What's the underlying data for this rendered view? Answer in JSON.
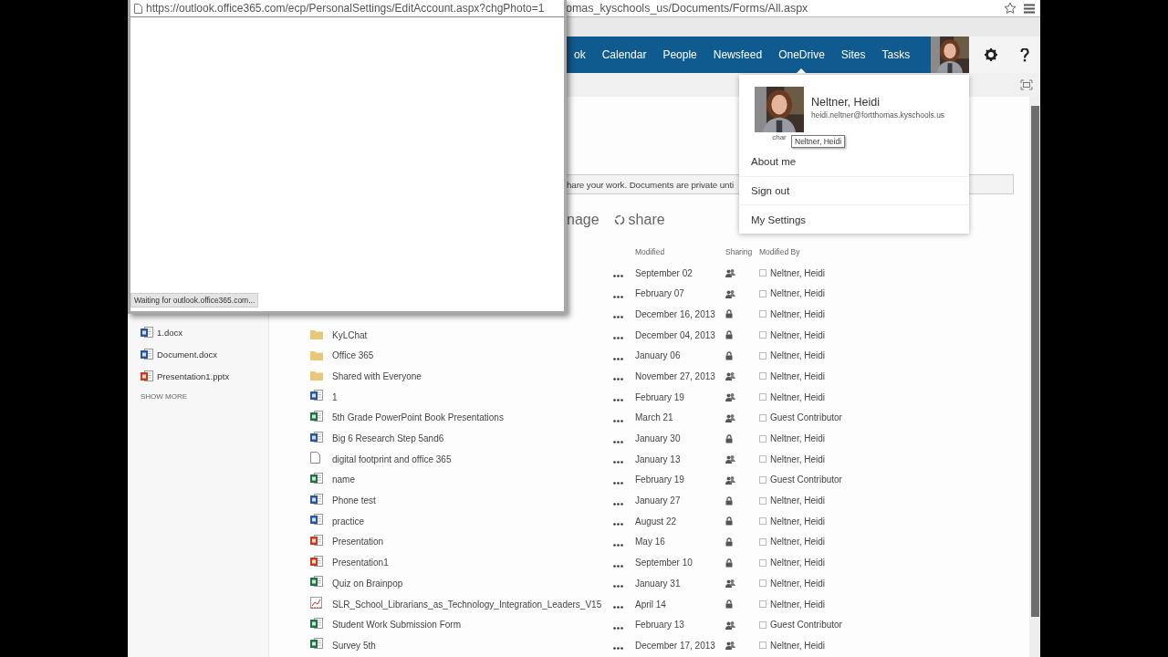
{
  "browser": {
    "address": "omas_kyschools_us/Documents/Forms/All.aspx"
  },
  "nav": {
    "items": [
      {
        "label": "ok",
        "selected": false
      },
      {
        "label": "Calendar",
        "selected": false
      },
      {
        "label": "People",
        "selected": false
      },
      {
        "label": "Newsfeed",
        "selected": false
      },
      {
        "label": "OneDrive",
        "selected": true
      },
      {
        "label": "Sites",
        "selected": false
      },
      {
        "label": "Tasks",
        "selected": false
      }
    ]
  },
  "recent": {
    "items": [
      {
        "name": "1.docx",
        "kind": "word"
      },
      {
        "name": "Document.docx",
        "kind": "word"
      },
      {
        "name": "Presentation1.pptx",
        "kind": "powerpoint"
      }
    ],
    "show_more": "SHOW MORE"
  },
  "banner": "hare your work. Documents are private unti",
  "commands": {
    "manage": "nage",
    "share": "share"
  },
  "table": {
    "columns": [
      "Modified",
      "Sharing",
      "Modified By"
    ],
    "rows": [
      {
        "kind": "hidden",
        "modified": "September 02",
        "shared": true,
        "modified_by": "Neltner, Heidi"
      },
      {
        "kind": "hidden",
        "modified": "February 07",
        "shared": true,
        "modified_by": "Neltner, Heidi"
      },
      {
        "kind": "hidden",
        "modified": "December 16, 2013",
        "shared": false,
        "modified_by": "Neltner, Heidi"
      },
      {
        "kind": "folder",
        "name": "KyLChat",
        "modified": "December 04, 2013",
        "shared": false,
        "modified_by": "Neltner, Heidi"
      },
      {
        "kind": "folder",
        "name": "Office 365",
        "modified": "January 06",
        "shared": false,
        "modified_by": "Neltner, Heidi"
      },
      {
        "kind": "folder",
        "name": "Shared with Everyone",
        "modified": "November 27, 2013",
        "shared": true,
        "modified_by": "Neltner, Heidi"
      },
      {
        "kind": "word",
        "name": "1",
        "modified": "February 19",
        "shared": true,
        "modified_by": "Neltner, Heidi"
      },
      {
        "kind": "excel",
        "name": "5th Grade PowerPoint Book Presentations",
        "modified": "March 21",
        "shared": true,
        "modified_by": "Guest Contributor"
      },
      {
        "kind": "word",
        "name": "Big 6 Research Step 5and6",
        "modified": "January 30",
        "shared": false,
        "modified_by": "Neltner, Heidi"
      },
      {
        "kind": "file",
        "name": "digital footprint and office 365",
        "modified": "January 13",
        "shared": true,
        "modified_by": "Neltner, Heidi"
      },
      {
        "kind": "excel",
        "name": "name",
        "modified": "February 19",
        "shared": true,
        "modified_by": "Guest Contributor"
      },
      {
        "kind": "word",
        "name": "Phone test",
        "modified": "January 27",
        "shared": false,
        "modified_by": "Neltner, Heidi"
      },
      {
        "kind": "word",
        "name": "practice",
        "modified": "August 22",
        "shared": false,
        "modified_by": "Neltner, Heidi"
      },
      {
        "kind": "powerpoint",
        "name": "Presentation",
        "modified": "May 16",
        "shared": false,
        "modified_by": "Neltner, Heidi"
      },
      {
        "kind": "powerpoint",
        "name": "Presentation1",
        "modified": "September 10",
        "shared": false,
        "modified_by": "Neltner, Heidi"
      },
      {
        "kind": "excel",
        "name": "Quiz on Brainpop",
        "modified": "January 31",
        "shared": true,
        "modified_by": "Neltner, Heidi"
      },
      {
        "kind": "chart",
        "name": "SLR_School_Librarians_as_Technology_Integration_Leaders_V15",
        "modified": "April 14",
        "shared": false,
        "modified_by": "Neltner, Heidi"
      },
      {
        "kind": "excel",
        "name": "Student Work Submission Form",
        "modified": "February 13",
        "shared": true,
        "modified_by": "Guest Contributor"
      },
      {
        "kind": "excel",
        "name": "Survey 5th",
        "modified": "December 17, 2013",
        "shared": true,
        "modified_by": "Neltner, Heidi"
      }
    ]
  },
  "account_menu": {
    "name": "Neltner, Heidi",
    "email": "heidi.neltner@fortthomas.kyschools.us",
    "photo_caption": "char",
    "tooltip": "Neltner, Heidi",
    "items": [
      "About me",
      "Sign out",
      "My Settings"
    ]
  },
  "popup": {
    "address": "https://outlook.office365.com/ecp/PersonalSettings/EditAccount.aspx?chgPhoto=1",
    "status": "Waiting for outlook.office365.com..."
  }
}
